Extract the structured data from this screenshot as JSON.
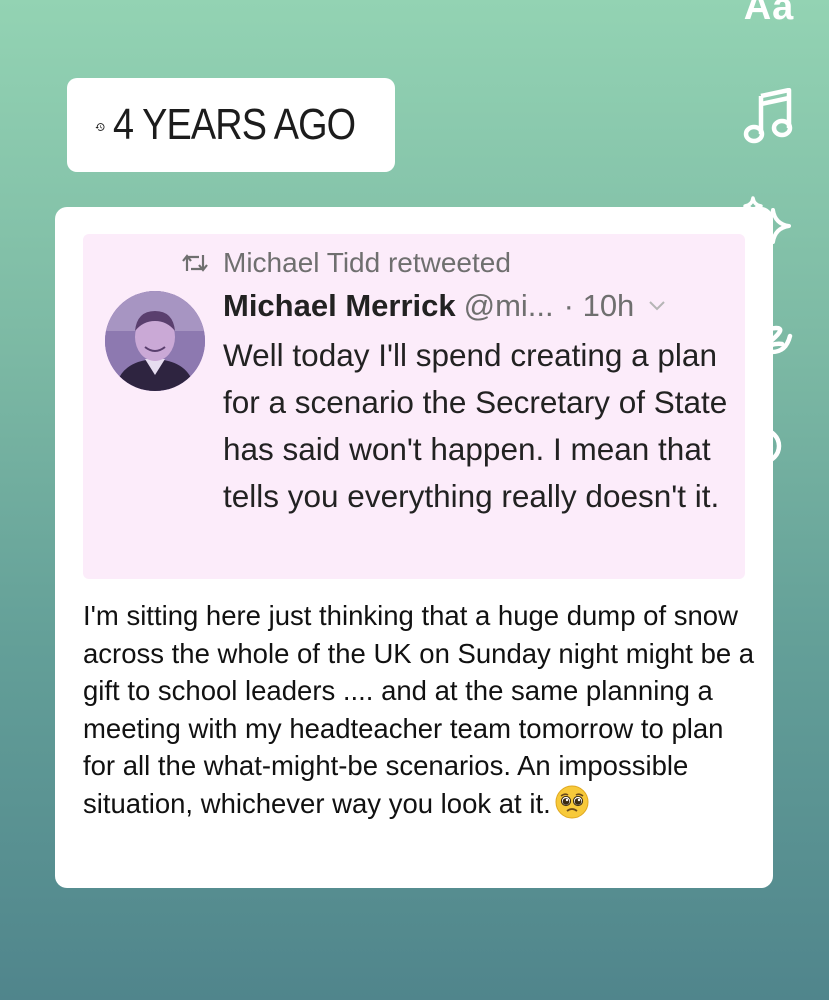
{
  "memory": {
    "label": "4 YEARS AGO",
    "icon": "history-icon"
  },
  "tools": {
    "text_label": "Aa",
    "icons": [
      "text-tool-icon",
      "music-icon",
      "sparkle-effects-icon",
      "draw-icon",
      "sticker-icon"
    ]
  },
  "tweet": {
    "retweeted_by": "Michael Tidd retweeted",
    "author_name": "Michael Merrick",
    "author_handle": "@mi...",
    "time": "· 10h",
    "text": "Well today I'll spend creating a plan for a scenario the Secretary of State has said won't happen. I mean that tells you everything really doesn't it."
  },
  "caption": {
    "text": "I'm sitting here just thinking that a huge dump of snow across the whole of the UK on Sunday night might be a gift to school leaders .... and at the same planning a meeting with my headteacher team tomorrow to plan for all the what-might-be scenarios. An impossible situation, whichever way you look at it.",
    "emoji": "pleading-face-emoji"
  },
  "colors": {
    "background_top": "#93d3b3",
    "background_bottom": "#50858c",
    "tweet_background": "#fcecfa",
    "avatar_tint": "#7a5aa8"
  }
}
